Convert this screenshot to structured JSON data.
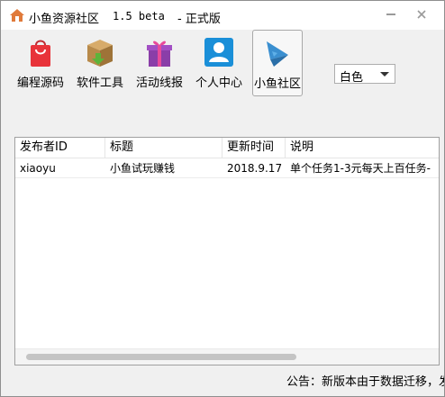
{
  "window": {
    "title": "小鱼资源社区",
    "version": "1.5 beta",
    "edition": "- 正式版"
  },
  "toolbar": {
    "items": [
      {
        "label": "编程源码",
        "icon": "shopping-bag-icon"
      },
      {
        "label": "软件工具",
        "icon": "package-box-icon"
      },
      {
        "label": "活动线报",
        "icon": "gift-box-icon"
      },
      {
        "label": "个人中心",
        "icon": "user-profile-icon"
      },
      {
        "label": "小鱼社区",
        "icon": "fish-icon",
        "selected": true
      }
    ]
  },
  "theme_select": {
    "value": "白色"
  },
  "list": {
    "columns": [
      "发布者ID",
      "标题",
      "更新时间",
      "说明"
    ],
    "rows": [
      [
        "xiaoyu",
        "小鱼试玩赚钱",
        "2018.9.17",
        "单个任务1-3元每天上百任务-"
      ]
    ]
  },
  "status": {
    "notice": "公告：新版本由于数据迁移，发"
  },
  "colors": {
    "bag": "#e8333a",
    "box": "#b88a4a",
    "gift": "#8a3ea8",
    "user": "#1a8fd8",
    "fish": "#3a8fd0"
  }
}
